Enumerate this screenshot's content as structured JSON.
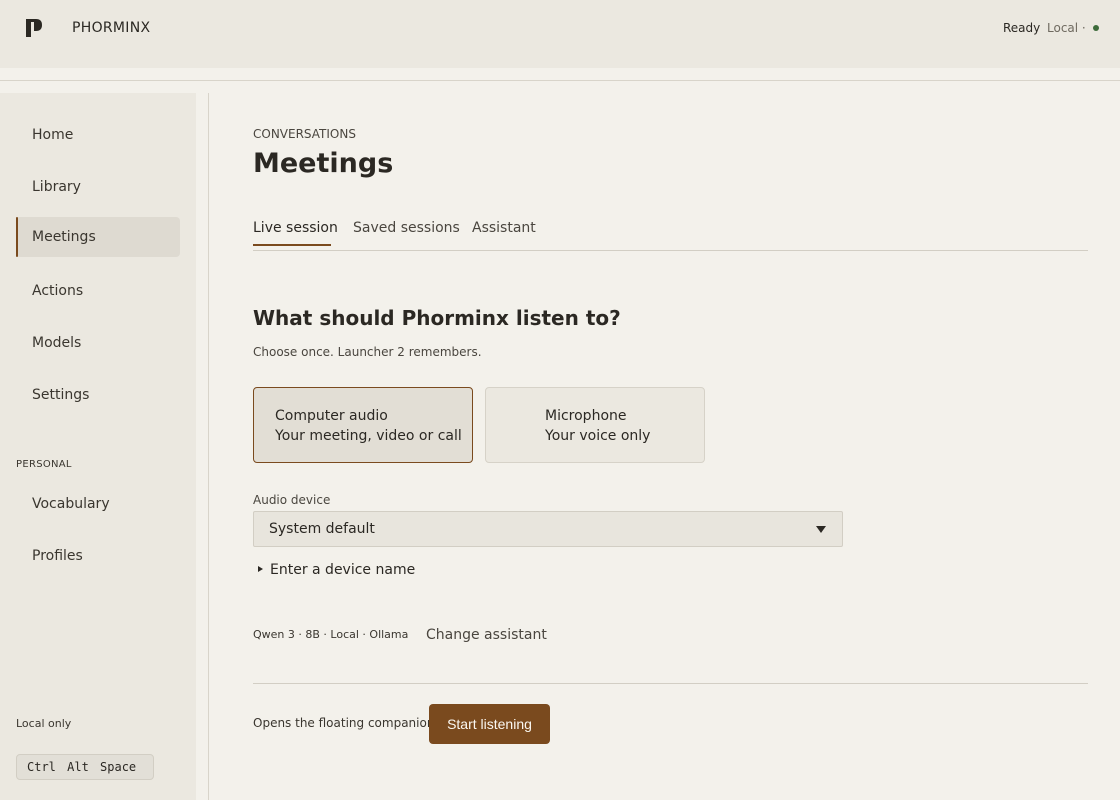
{
  "header": {
    "app_name": "PHORMINX",
    "status_ready": "Ready",
    "status_local": "Local ·",
    "status_dot_color": "#3d6b3a"
  },
  "sidebar": {
    "items": [
      {
        "label": "Home"
      },
      {
        "label": "Library"
      },
      {
        "label": "Meetings",
        "active": true
      },
      {
        "label": "Actions"
      },
      {
        "label": "Models"
      },
      {
        "label": "Settings"
      }
    ],
    "section_personal": "PERSONAL",
    "personal_items": [
      {
        "label": "Vocabulary"
      },
      {
        "label": "Profiles"
      }
    ],
    "local_only": "Local only",
    "shortcut": "Ctrl Alt Space"
  },
  "main": {
    "eyebrow": "CONVERSATIONS",
    "title": "Meetings",
    "tabs": [
      {
        "label": "Live session",
        "active": true
      },
      {
        "label": "Saved sessions"
      },
      {
        "label": "Assistant"
      }
    ],
    "question": "What should Phorminx listen to?",
    "hint": "Choose once. Launcher 2 remembers.",
    "sources": [
      {
        "title": "Computer audio",
        "subtitle": "Your meeting, video or call",
        "selected": true
      },
      {
        "title": "Microphone",
        "subtitle": "Your voice only",
        "selected": false
      }
    ],
    "audio_device_label": "Audio device",
    "audio_device_value": "System default",
    "device_name_toggle": "Enter a device name",
    "model_meta": "Qwen 3 · 8B · Local · Ollama",
    "change_assistant": "Change assistant",
    "footer_hint": "Opens the floating companion.",
    "start_button": "Start listening"
  },
  "colors": {
    "accent": "#7a4a1e",
    "background": "#f3f1eb",
    "sidebar_bg": "#ebe8e0"
  }
}
